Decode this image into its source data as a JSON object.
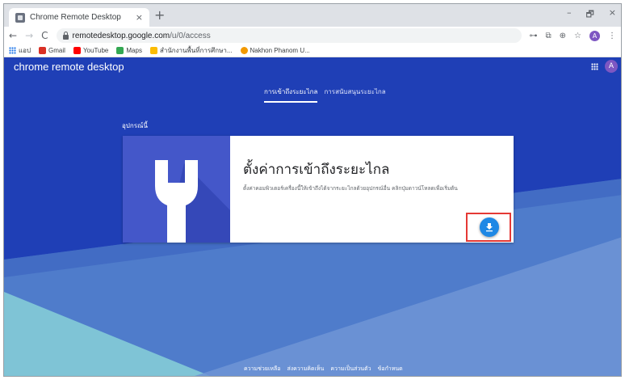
{
  "browser": {
    "tab_title": "Chrome Remote Desktop",
    "tab_close": "×",
    "new_tab": "+",
    "window_controls": {
      "minimize": "–",
      "restore": "🗗",
      "close": "×"
    },
    "url_host": "remotedesktop.google.com",
    "url_path": "/u/0/access",
    "profile_initial": "A"
  },
  "bookmarks": [
    {
      "label": "แอป",
      "color": "#1a73e8"
    },
    {
      "label": "Gmail",
      "color": "#d93025"
    },
    {
      "label": "YouTube",
      "color": "#ff0000"
    },
    {
      "label": "Maps",
      "color": "#34a853"
    },
    {
      "label": "สำนักงานพื้นที่การศึกษา...",
      "color": "#fbbc04"
    },
    {
      "label": "Nakhon Phanom U...",
      "color": "#f29900"
    }
  ],
  "app": {
    "brand": "chrome remote desktop",
    "account_initial": "A",
    "tabs": [
      {
        "label": "การเข้าถึงระยะไกล",
        "active": true
      },
      {
        "label": "การสนับสนุนระยะไกล",
        "active": false
      }
    ],
    "section_label": "อุปกรณ์นี้",
    "card": {
      "title": "ตั้งค่าการเข้าถึงระยะไกล",
      "description": "ตั้งค่าคอมพิวเตอร์เครื่องนี้ให้เข้าถึงได้จากระยะไกลด้วยอุปกรณ์อื่น คลิกปุ่มดาวน์โหลดเพื่อเริ่มต้น"
    },
    "footer": [
      "ความช่วยเหลือ",
      "ส่งความคิดเห็น",
      "ความเป็นส่วนตัว",
      "ข้อกำหนด"
    ]
  },
  "colors": {
    "page_background": "#1f3fb6",
    "download_button": "#1e88e5",
    "highlight_box": "#e53935"
  }
}
